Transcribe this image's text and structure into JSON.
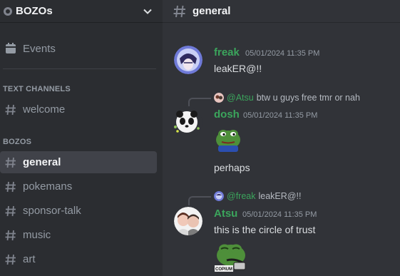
{
  "server": {
    "name": "BOZOs"
  },
  "sidebar": {
    "events_label": "Events",
    "categories": [
      {
        "label": "TEXT CHANNELS"
      },
      {
        "label": "BOZOS"
      }
    ],
    "channels": [
      {
        "name": "welcome"
      },
      {
        "name": "general"
      },
      {
        "name": "pokemans"
      },
      {
        "name": "sponsor-talk"
      },
      {
        "name": "music"
      },
      {
        "name": "art"
      }
    ]
  },
  "header": {
    "channel": "general"
  },
  "messages": [
    {
      "author": "freak",
      "author_color": "#3ba55c",
      "timestamp": "05/01/2024 11:35 PM",
      "text": "leakER@!!"
    },
    {
      "reply_to": {
        "author": "@Atsu",
        "text": "btw u guys free tmr or nah"
      },
      "author": "dosh",
      "author_color": "#3ba55c",
      "timestamp": "05/01/2024 11:35 PM",
      "sticker": "pepe-sticker",
      "text": "perhaps"
    },
    {
      "reply_to": {
        "author": "@freak",
        "text": "leakER@!!"
      },
      "author": "Atsu",
      "author_color": "#3ba55c",
      "timestamp": "05/01/2024 11:35 PM",
      "text": "this is the circle of trust",
      "sticker": "copium-pepe-sticker",
      "sticker_caption": "COPIUM"
    }
  ],
  "colors": {
    "background": "#313338",
    "sidebar": "#2b2d31",
    "active": "#404249",
    "username": "#3ba55c"
  }
}
